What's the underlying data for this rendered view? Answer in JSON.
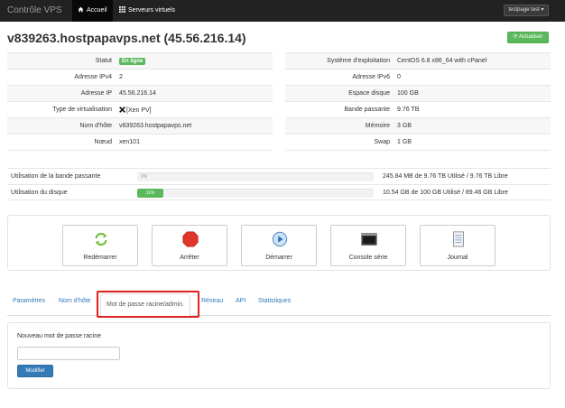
{
  "navbar": {
    "brand": "Contrôle VPS",
    "items": [
      {
        "label": "Accueil",
        "icon": "home-icon"
      },
      {
        "label": "Serveurs virtuels",
        "icon": "grid-icon"
      }
    ],
    "user_menu": "testpage test"
  },
  "header": {
    "title": "v839263.hostpapavps.net (45.56.216.14)",
    "refresh_label": "Actualiser"
  },
  "info_left": [
    {
      "label": "Statut",
      "value": "En ligne"
    },
    {
      "label": "Adresse IPv4",
      "value": "2"
    },
    {
      "label": "Adresse IP",
      "value": "45.56.216.14"
    },
    {
      "label": "Type de virtualisation",
      "value": "[Xen PV]"
    },
    {
      "label": "Nom d'hôte",
      "value": "v839263.hostpapavps.net"
    },
    {
      "label": "Nœud",
      "value": "xen101"
    }
  ],
  "info_right": [
    {
      "label": "Système d'exploitation",
      "value": "CentOS 6.8 x86_64 with cPanel"
    },
    {
      "label": "Adresse IPv6",
      "value": "0"
    },
    {
      "label": "Espace disque",
      "value": "100 GB"
    },
    {
      "label": "Bande passante",
      "value": "9.76 TB"
    },
    {
      "label": "Mémoire",
      "value": "3 GB"
    },
    {
      "label": "Swap",
      "value": "1 GB"
    }
  ],
  "usage": {
    "bandwidth": {
      "label": "Utilisation de la bande passante",
      "percent_label": "0%",
      "percent": 0,
      "info": "245.84 MB de 9.76 TB Utilisé / 9.76 TB Libre"
    },
    "disk": {
      "label": "Utilisation du disque",
      "percent_label": "11%",
      "percent": 11,
      "info": "10.54 GB de 100 GB Utilisé / 89.46 GB Libre"
    }
  },
  "actions": [
    {
      "label": "Redémarrer",
      "icon": "restart-icon"
    },
    {
      "label": "Arrêter",
      "icon": "stop-icon"
    },
    {
      "label": "Démarrer",
      "icon": "play-icon"
    },
    {
      "label": "Console série",
      "icon": "console-icon"
    },
    {
      "label": "Journal",
      "icon": "journal-icon"
    }
  ],
  "tabs": [
    {
      "label": "Paramètres"
    },
    {
      "label": "Nom d'hôte"
    },
    {
      "label": "Mot de passe racine/admin."
    },
    {
      "label": "Réseau"
    },
    {
      "label": "API"
    },
    {
      "label": "Statistiques"
    }
  ],
  "form": {
    "label": "Nouveau mot de passe racine",
    "value": "",
    "placeholder": "",
    "submit_label": "Modifier"
  },
  "colors": {
    "navbar": "#222222",
    "success": "#5cb85c",
    "primary": "#337ab7",
    "highlight": "#e02020"
  }
}
